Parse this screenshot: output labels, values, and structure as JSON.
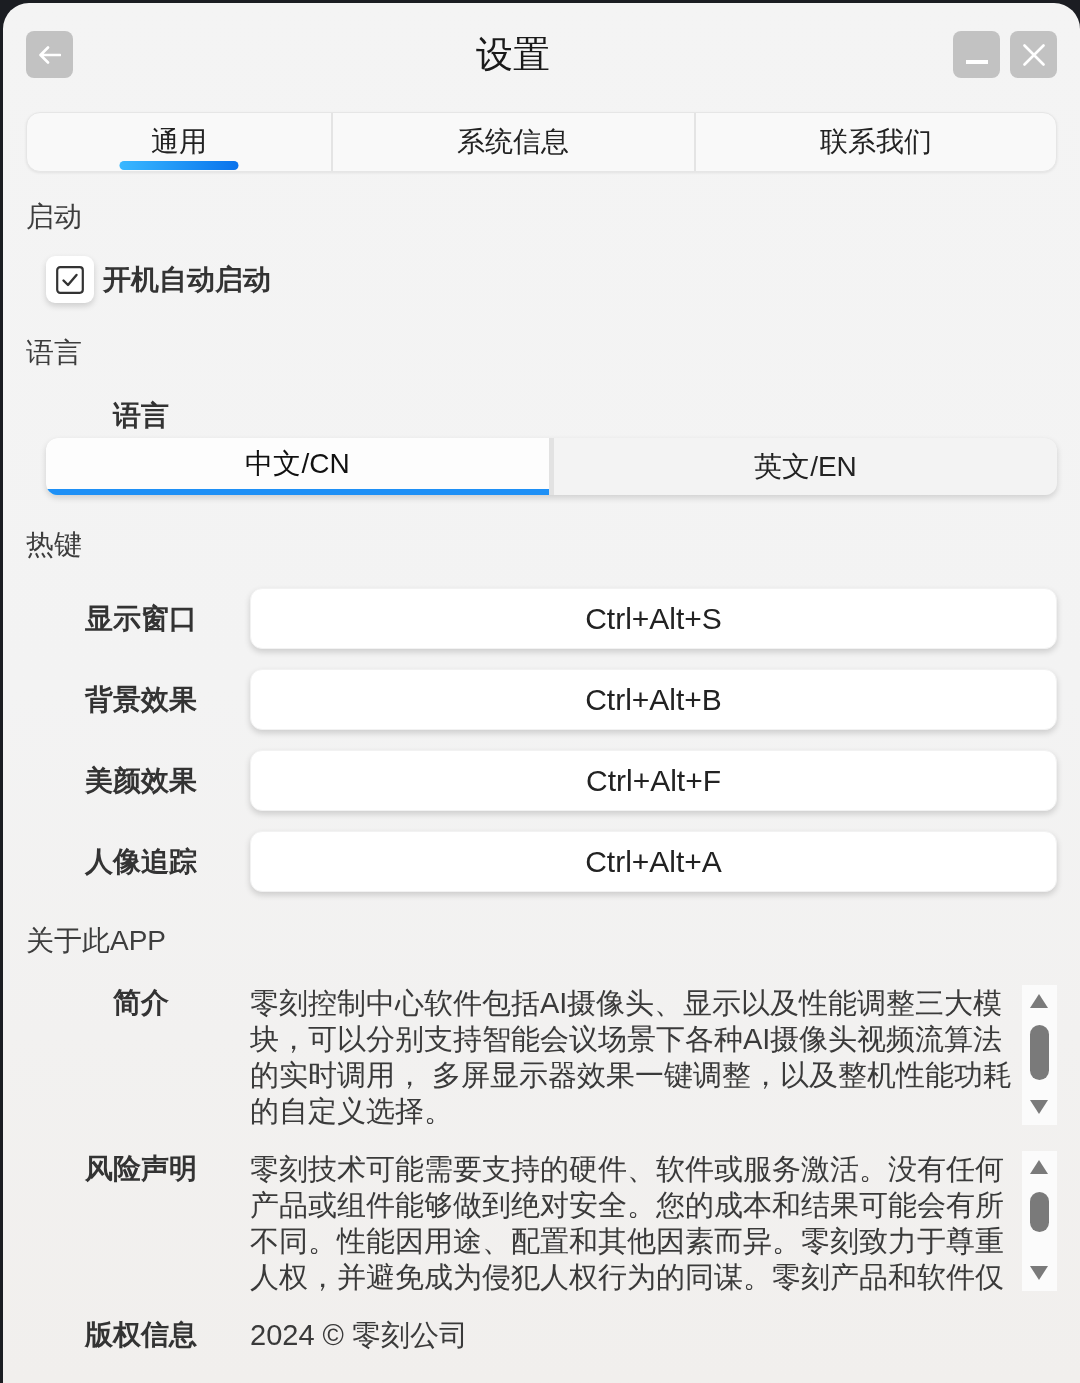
{
  "window": {
    "title": "设置"
  },
  "tabs": [
    {
      "label": "通用",
      "selected": true
    },
    {
      "label": "系统信息",
      "selected": false
    },
    {
      "label": "联系我们",
      "selected": false
    }
  ],
  "sections": [
    {
      "kind": "checkboxes",
      "title": "启动",
      "items": [
        {
          "label": "开机自动启动",
          "checked": true
        }
      ]
    },
    {
      "kind": "segmented",
      "title": "语言",
      "label": "语言",
      "options": [
        {
          "label": "中文/CN",
          "selected": true
        },
        {
          "label": "英文/EN",
          "selected": false
        }
      ]
    },
    {
      "kind": "hotkeys",
      "title": "热键",
      "items": [
        {
          "label": "显示窗口",
          "value": "Ctrl+Alt+S"
        },
        {
          "label": "背景效果",
          "value": "Ctrl+Alt+B"
        },
        {
          "label": "美颜效果",
          "value": "Ctrl+Alt+F"
        },
        {
          "label": "人像追踪",
          "value": "Ctrl+Alt+A"
        }
      ]
    },
    {
      "kind": "about",
      "title": "关于此APP",
      "items": [
        {
          "kind": "scroll_text",
          "label": "简介",
          "text": "零刻控制中心软件包括AI摄像头、显示以及性能调整三大模块，可以分别支持智能会议场景下各种AI摄像头视频流算法的实时调用， 多屏显示器效果一键调整，以及整机性能功耗的自定义选择。"
        },
        {
          "kind": "scroll_text",
          "label": "风险声明",
          "text": "零刻技术可能需要支持的硬件、软件或服务激活。没有任何产品或组件能够做到绝对安全。您的成本和结果可能会有所不同。性能因用途、配置和其他因素而异。零刻致力于尊重人权，并避免成为侵犯人权行为的同谋。零刻产品和软件仅"
        },
        {
          "kind": "plain",
          "label": "版权信息",
          "text": "2024 © 零刻公司"
        }
      ]
    }
  ]
}
